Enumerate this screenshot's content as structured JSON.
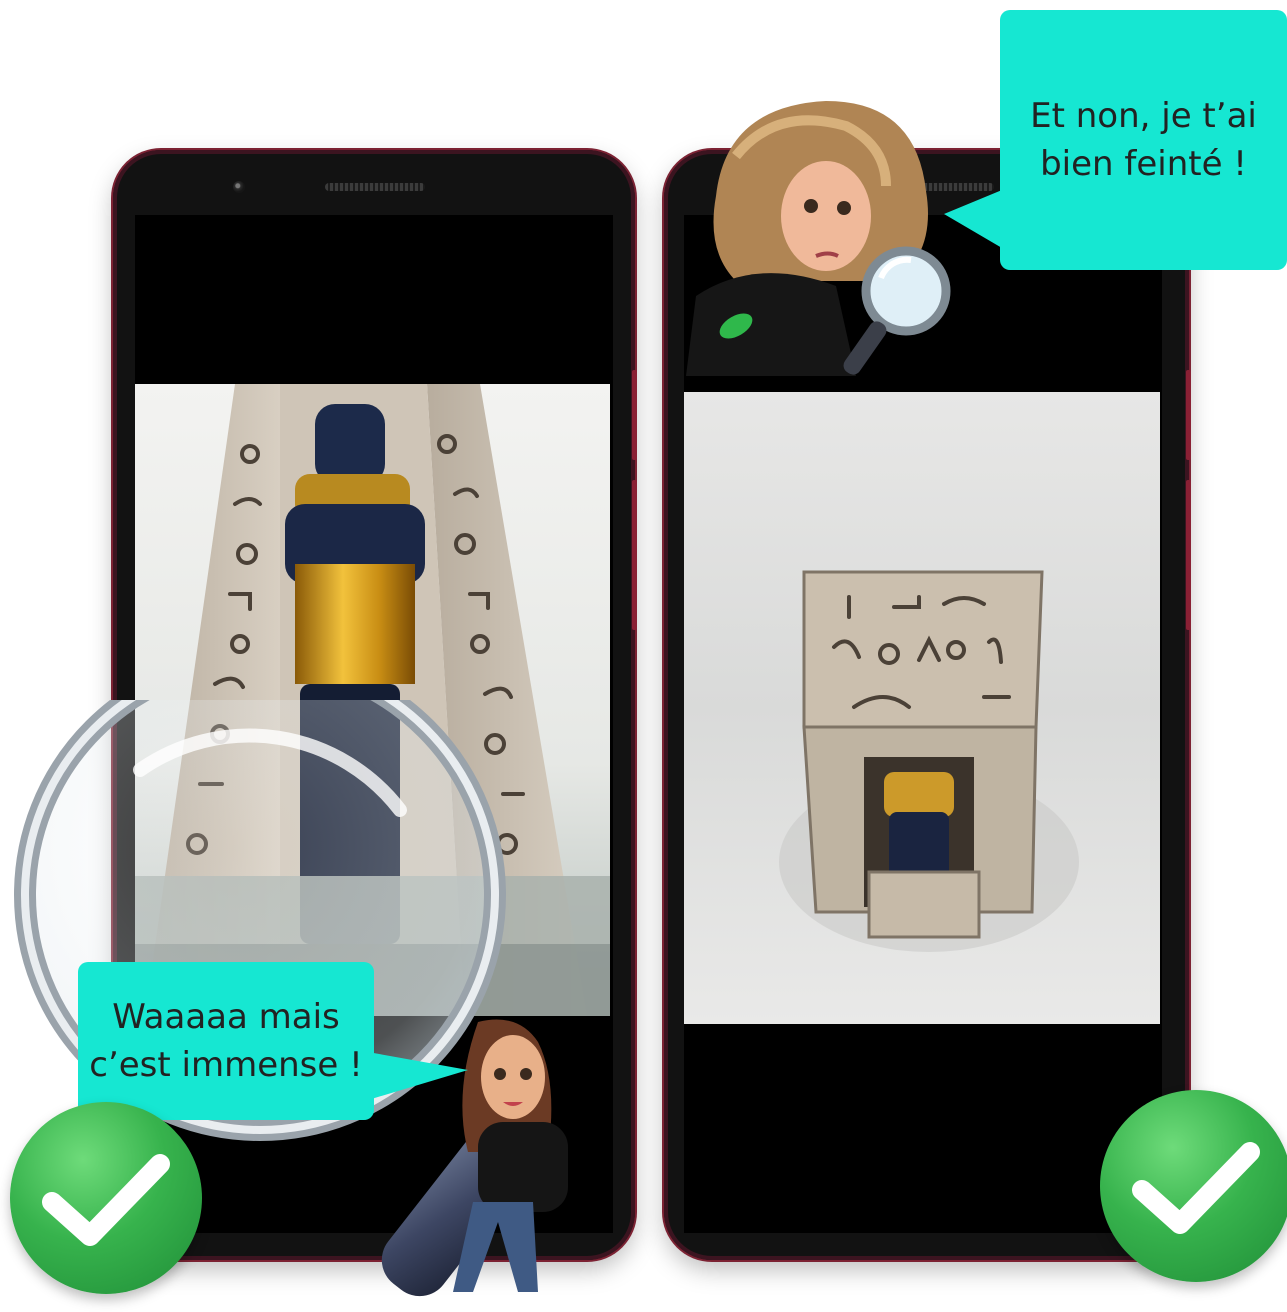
{
  "bubbles": {
    "left_text_line1": "Waaaaa mais",
    "left_text_line2": "c’est immense !",
    "right_text_line1": "Et non, je t’ai",
    "right_text_line2": "bien feinté  !"
  },
  "icons": {
    "check_left": "checkmark-circle-icon",
    "check_right": "checkmark-circle-icon",
    "magnifier_left": "magnifying-glass-icon",
    "magnifier_right": "magnifying-glass-icon"
  },
  "colors": {
    "bubble": "#16e7d2",
    "check_green": "#37b34d",
    "phone_body": "#121212",
    "phone_accent": "#8a2034"
  }
}
